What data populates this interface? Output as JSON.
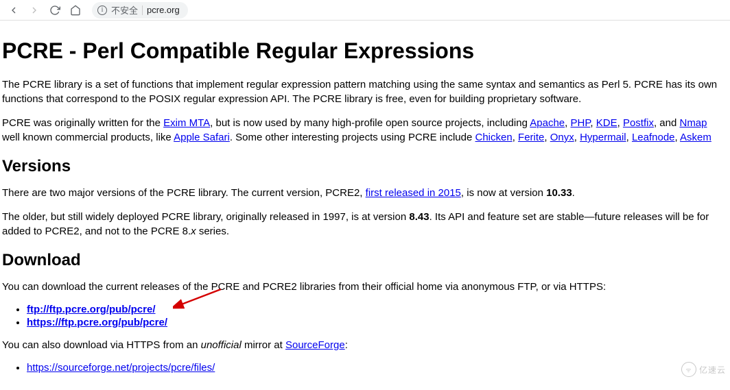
{
  "toolbar": {
    "url_security": "不安全",
    "url_display": "pcre.org"
  },
  "page": {
    "h1": "PCRE - Perl Compatible Regular Expressions",
    "p1_a": "The PCRE library is a set of functions that implement regular expression pattern matching using the same syntax and semantics as Perl 5. PCRE has its own",
    "p1_b": "functions that correspond to the POSIX regular expression API. The PCRE library is free, even for building proprietary software.",
    "p2_a": "PCRE was originally written for the ",
    "p2_link_exim": "Exim MTA",
    "p2_b": ", but is now used by many high-profile open source projects, including ",
    "links_row1": {
      "apache": "Apache",
      "php": "PHP",
      "kde": "KDE",
      "postfix": "Postfix",
      "nmap": "Nmap"
    },
    "p2_c": ", and ",
    "p3_a": "well known commercial products, like ",
    "p3_link_safari": "Apple Safari",
    "p3_b": ". Some other interesting projects using PCRE include ",
    "links_row2": {
      "chicken": "Chicken",
      "ferite": "Ferite",
      "onyx": "Onyx",
      "hypermail": "Hypermail",
      "leafnode": "Leafnode",
      "askem": "Askem"
    },
    "h2_versions": "Versions",
    "v_p1_a": "There are two major versions of the PCRE library. The current version, PCRE2, ",
    "v_link_2015": "first released in 2015",
    "v_p1_b": ", is now at version ",
    "v_version": "10.33",
    "v_p1_c": ".",
    "v_p2_a": "The older, but still widely deployed PCRE library, originally released in 1997, is at version ",
    "v_old_version": "8.43",
    "v_p2_b": ". Its API and feature set are stable—future releases will be for",
    "v_p2_c": "added to PCRE2, and not to the PCRE 8.",
    "v_p2_d": "x",
    "v_p2_e": " series.",
    "h2_download": "Download",
    "d_p1": "You can download the current releases of the PCRE and PCRE2 libraries from their official home via anonymous FTP, or via HTTPS:",
    "d_link_ftp": "ftp://ftp.pcre.org/pub/pcre/",
    "d_link_https": "https://ftp.pcre.org/pub/pcre/",
    "d_p2_a": "You can also download via HTTPS from an ",
    "d_p2_unofficial": "unofficial",
    "d_p2_b": " mirror at ",
    "d_link_sf": "SourceForge",
    "d_p2_c": ":",
    "d_link_sf_url": "https://sourceforge.net/projects/pcre/files/"
  },
  "watermark": {
    "text": "亿速云"
  }
}
